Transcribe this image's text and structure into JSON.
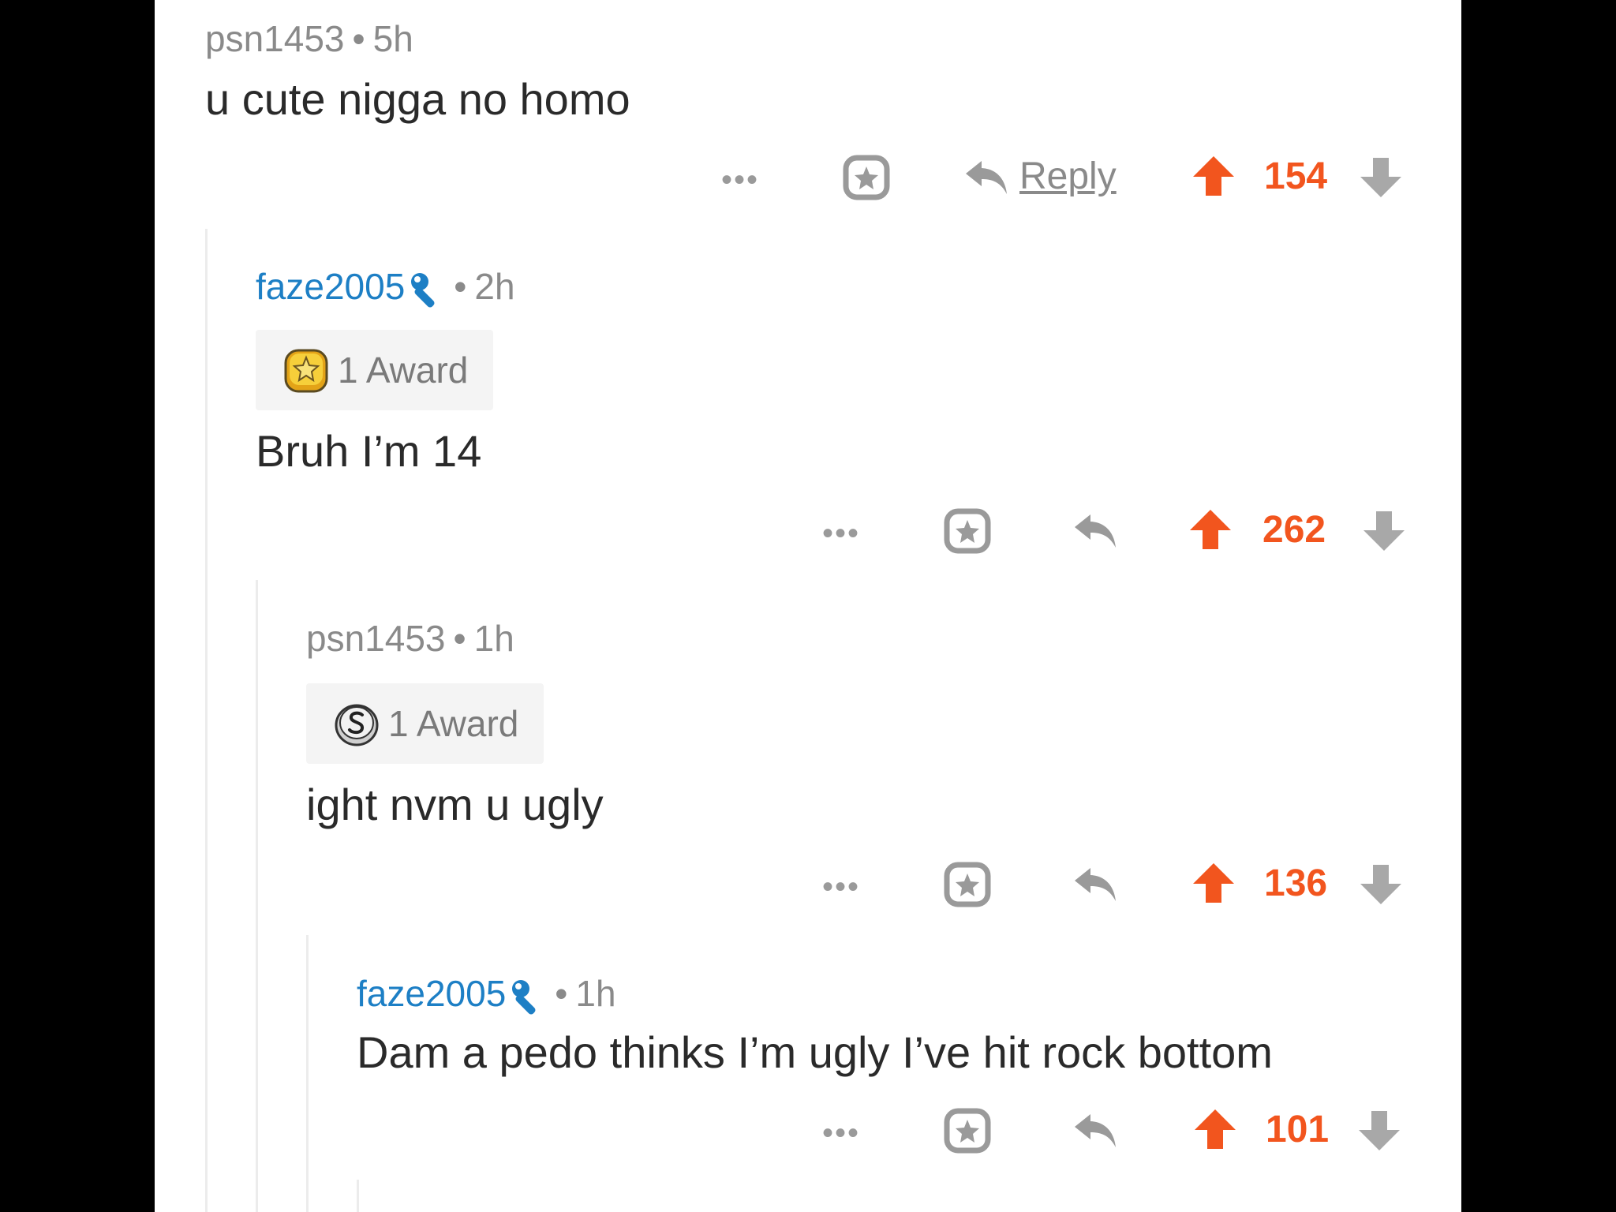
{
  "comments": [
    {
      "username": "psn1453",
      "time": "5h",
      "separator": "•",
      "text": "u cute nigga no homo",
      "score": "154",
      "reply_label": "Reply",
      "more": "•••"
    },
    {
      "username": "faze2005",
      "time": "2h",
      "separator": "•",
      "award_label": "1 Award",
      "text": "Bruh I’m 14",
      "score": "262",
      "more": "•••"
    },
    {
      "username": "psn1453",
      "time": "1h",
      "separator": "•",
      "award_label": "1 Award",
      "text": "ight nvm u ugly",
      "score": "136",
      "more": "•••"
    },
    {
      "username": "faze2005",
      "time": "1h",
      "separator": "•",
      "text": "Dam a pedo thinks I’m ugly I’ve hit rock bottom",
      "score": "101",
      "more": "•••"
    }
  ],
  "colors": {
    "upvote": "#f2551e",
    "username_mod": "#1d7fc5",
    "muted": "#8a8a8a",
    "text": "#2a2a2a"
  },
  "icons": [
    "more-icon",
    "award-star-icon",
    "reply-arrow-icon",
    "upvote-arrow-icon",
    "downvote-arrow-icon",
    "mod-wrench-icon",
    "gold-award-icon",
    "silver-award-icon"
  ]
}
